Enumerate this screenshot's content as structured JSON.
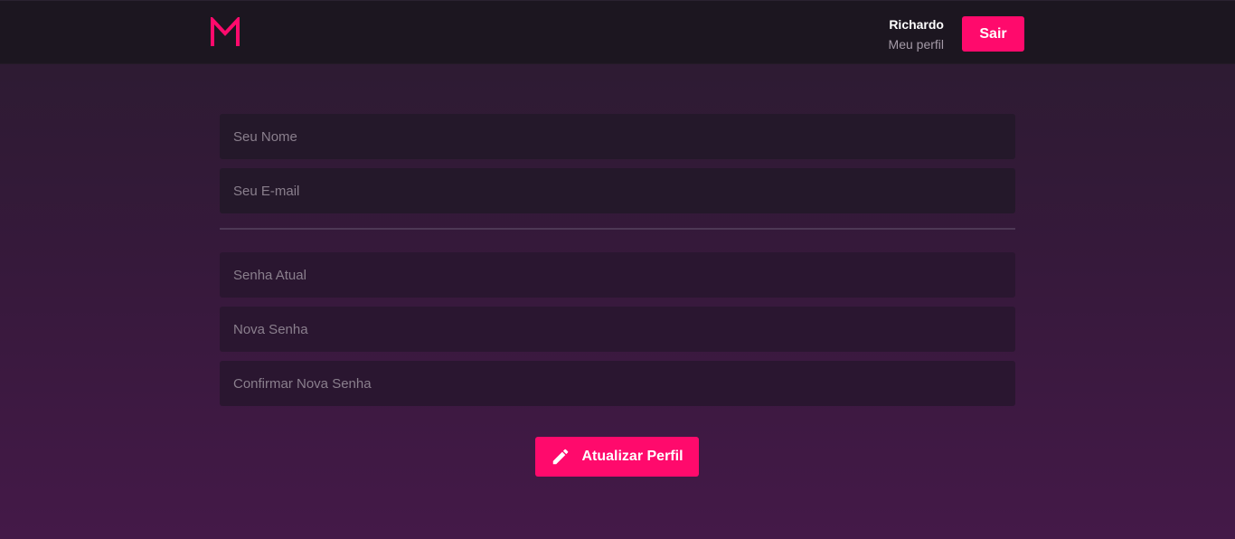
{
  "header": {
    "logo_letter": "M",
    "user_name": "Richardo",
    "profile_link": "Meu perfil",
    "logout_label": "Sair"
  },
  "form": {
    "name_placeholder": "Seu Nome",
    "email_placeholder": "Seu E-mail",
    "current_password_placeholder": "Senha Atual",
    "new_password_placeholder": "Nova Senha",
    "confirm_password_placeholder": "Confirmar Nova Senha",
    "submit_label": "Atualizar Perfil",
    "submit_icon": "pencil-icon"
  },
  "colors": {
    "accent": "#ff0a6c",
    "header_bg": "#1c1620",
    "input_bg": "#24182a"
  }
}
